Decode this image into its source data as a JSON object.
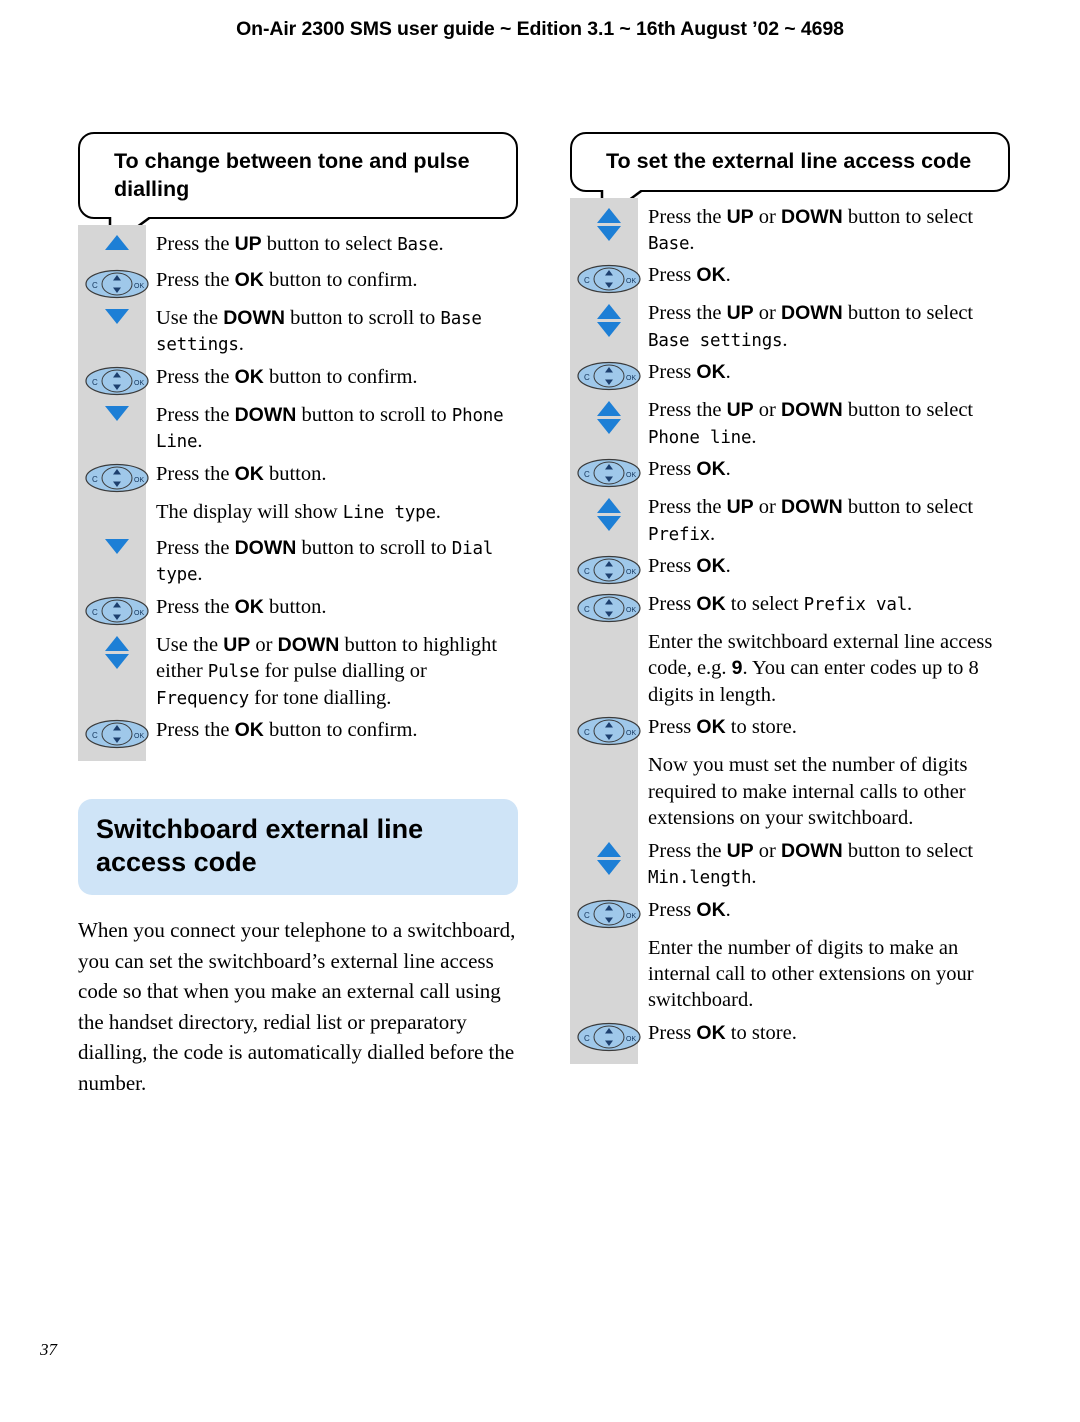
{
  "header": {
    "text": "On-Air 2300 SMS user guide ~ Edition 3.1 ~ 16th August ’02 ~ 4698"
  },
  "page_number": "37",
  "left_column": {
    "bubble_heading": "To change between tone and pulse dialling",
    "steps": [
      {
        "icon": "up-arrow-icon",
        "pre": "Press the ",
        "b1": "UP",
        "mid": " button to select ",
        "mono": "Base",
        "post": "."
      },
      {
        "icon": "nav-key-icon",
        "pre": "Press the ",
        "b1": "OK",
        "mid": " button to confirm.",
        "mono": "",
        "post": ""
      },
      {
        "icon": "down-arrow-icon",
        "pre": "Use the ",
        "b1": "DOWN",
        "mid": " button to scroll to ",
        "mono": "Base settings",
        "post": "."
      },
      {
        "icon": "nav-key-icon",
        "pre": "Press the ",
        "b1": "OK",
        "mid": " button to confirm.",
        "mono": "",
        "post": ""
      },
      {
        "icon": "down-arrow-icon",
        "pre": "Press the ",
        "b1": "DOWN",
        "mid": " button to scroll to ",
        "mono": "Phone Line",
        "post": "."
      },
      {
        "icon": "nav-key-icon",
        "pre": "Press the ",
        "b1": "OK",
        "mid": " button.",
        "mono": "",
        "post": ""
      },
      {
        "icon": "none",
        "pre": "The display will show ",
        "b1": "",
        "mid": "",
        "mono": "Line type",
        "post": "."
      },
      {
        "icon": "down-arrow-icon",
        "pre": "Press the ",
        "b1": "DOWN",
        "mid": " button to scroll to ",
        "mono": "Dial type",
        "post": "."
      },
      {
        "icon": "nav-key-icon",
        "pre": "Press the ",
        "b1": "OK",
        "mid": " button.",
        "mono": "",
        "post": ""
      },
      {
        "icon": "up-down-arrow-icon",
        "pre": "Use the ",
        "b1": "UP",
        "mid2": " or ",
        "b2": "DOWN",
        "mid": " button to highlight either ",
        "mono": "Pulse",
        "mid3": " for pulse dialling or ",
        "mono2": "Frequency",
        "post": " for tone dialling."
      },
      {
        "icon": "nav-key-icon",
        "pre": "Press the ",
        "b1": "OK",
        "mid": " button to confirm.",
        "mono": "",
        "post": ""
      }
    ],
    "title_box": "Switchboard external line access code",
    "body_paragraph": "When you connect your telephone to a switchboard, you can set the switchboard’s external line access code so that when you make an external call using the handset directory, redial list or preparatory dialling, the code is automatically dialled before the number."
  },
  "right_column": {
    "bubble_heading": "To set the external line access code",
    "steps": [
      {
        "icon": "up-down-arrow-icon",
        "pre": "Press the ",
        "b1": "UP",
        "mid2": " or ",
        "b2": "DOWN",
        "mid": " button to select ",
        "mono": "Base",
        "post": "."
      },
      {
        "icon": "nav-key-icon",
        "pre": "Press ",
        "b1": "OK",
        "mid": ".",
        "mono": "",
        "post": ""
      },
      {
        "icon": "up-down-arrow-icon",
        "pre": "Press the ",
        "b1": "UP",
        "mid2": " or ",
        "b2": "DOWN",
        "mid": " button to select ",
        "mono": "Base settings",
        "post": "."
      },
      {
        "icon": "nav-key-icon",
        "pre": "Press ",
        "b1": "OK",
        "mid": ".",
        "mono": "",
        "post": ""
      },
      {
        "icon": "up-down-arrow-icon",
        "pre": "Press the ",
        "b1": "UP",
        "mid2": " or ",
        "b2": "DOWN",
        "mid": " button to select ",
        "mono": "Phone line",
        "post": "."
      },
      {
        "icon": "nav-key-icon",
        "pre": "Press ",
        "b1": "OK",
        "mid": ".",
        "mono": "",
        "post": ""
      },
      {
        "icon": "up-down-arrow-icon",
        "pre": "Press the ",
        "b1": "UP",
        "mid2": " or ",
        "b2": "DOWN",
        "mid": " button to select ",
        "mono": "Prefix",
        "post": "."
      },
      {
        "icon": "nav-key-icon",
        "pre": "Press ",
        "b1": "OK",
        "mid": ".",
        "mono": "",
        "post": ""
      },
      {
        "icon": "nav-key-icon",
        "pre": "Press ",
        "b1": "OK",
        "mid": " to select ",
        "mono": "Prefix val",
        "post": "."
      },
      {
        "icon": "none",
        "pre": "Enter the switchboard external line access code, e.g. ",
        "b1": "9",
        "mid": ". You can enter codes up to 8 digits in length.",
        "mono": "",
        "post": ""
      },
      {
        "icon": "nav-key-icon",
        "pre": "Press ",
        "b1": "OK",
        "mid": " to store.",
        "mono": "",
        "post": ""
      },
      {
        "icon": "none",
        "pre": "Now you must set the number of digits required to make internal calls to other extensions on your switchboard.",
        "b1": "",
        "mid": "",
        "mono": "",
        "post": ""
      },
      {
        "icon": "up-down-arrow-icon",
        "pre": "Press the ",
        "b1": "UP",
        "mid2": " or ",
        "b2": "DOWN",
        "mid": " button to select ",
        "mono": "Min.length",
        "post": "."
      },
      {
        "icon": "nav-key-icon",
        "pre": "Press ",
        "b1": "OK",
        "mid": ".",
        "mono": "",
        "post": ""
      },
      {
        "icon": "none",
        "pre": "Enter the number of digits to make an internal call to other extensions on your switchboard.",
        "b1": "",
        "mid": "",
        "mono": "",
        "post": ""
      },
      {
        "icon": "nav-key-icon",
        "pre": "Press ",
        "b1": "OK",
        "mid": " to store.",
        "mono": "",
        "post": ""
      }
    ]
  },
  "colors": {
    "arrow_blue": "#1d7fd6",
    "key_blue": "#9fc8ea",
    "title_box_blue": "#cfe4f7",
    "track_grey": "#d6d6d6"
  },
  "icon_labels": {
    "nav_key_left": "C",
    "nav_key_right": "OK"
  }
}
